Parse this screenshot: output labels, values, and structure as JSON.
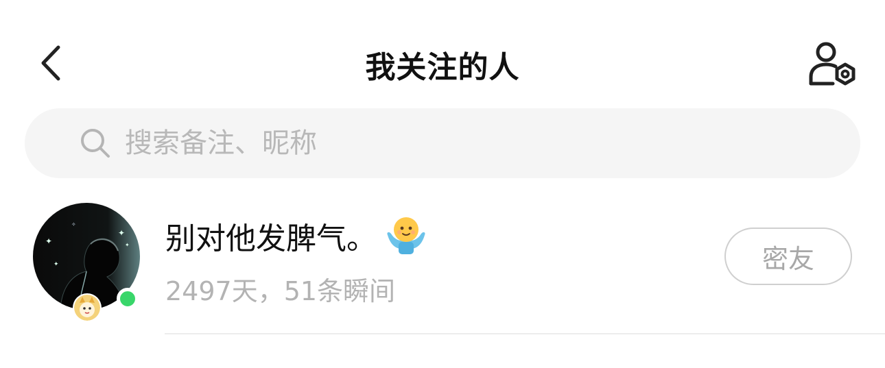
{
  "header": {
    "title": "我关注的人",
    "back_icon": "chevron-left-icon",
    "settings_icon": "user-settings-icon"
  },
  "search": {
    "placeholder": "搜索备注、昵称",
    "value": "",
    "icon": "search-icon"
  },
  "contacts": [
    {
      "name": "别对他发脾气。",
      "name_emoji": "hugging-face-emoji",
      "meta": "2497天，51条瞬间",
      "online": true,
      "tag_label": "密友"
    }
  ],
  "colors": {
    "online": "#39d66a",
    "placeholder": "#b8b8b8",
    "meta_text": "#b3b3b3",
    "search_bg": "#f5f5f5"
  }
}
